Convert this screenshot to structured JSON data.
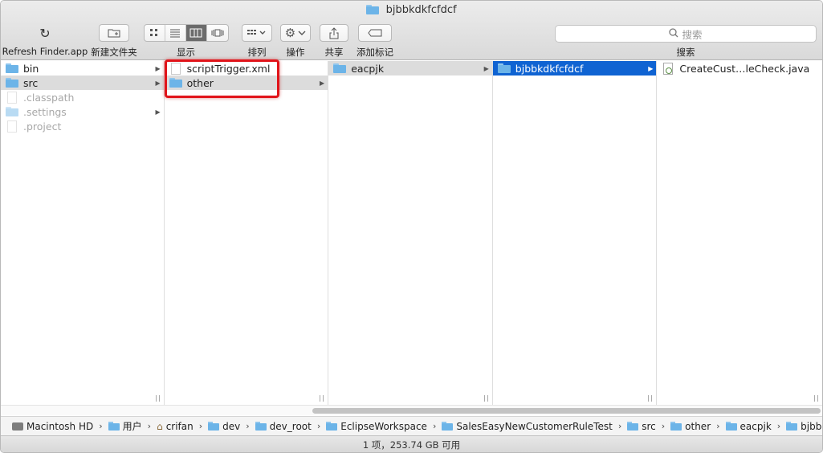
{
  "window": {
    "title": "bjbbkdkfcfdcf"
  },
  "toolbar": {
    "refresh_label": "Refresh Finder.app",
    "new_folder_label": "新建文件夹",
    "view_label": "显示",
    "arrange_label": "排列",
    "action_label": "操作",
    "share_label": "共享",
    "tag_label": "添加标记",
    "search_placeholder": "搜索",
    "search_label": "搜索"
  },
  "columns": [
    {
      "items": [
        {
          "name": "bin",
          "kind": "folder",
          "arrow": true
        },
        {
          "name": "src",
          "kind": "folder",
          "arrow": true,
          "selected": "gray"
        },
        {
          "name": ".classpath",
          "kind": "file",
          "dim": true
        },
        {
          "name": ".settings",
          "kind": "folder",
          "arrow": true,
          "dim": true
        },
        {
          "name": ".project",
          "kind": "file",
          "dim": true
        }
      ]
    },
    {
      "items": [
        {
          "name": "scriptTrigger.xml",
          "kind": "file"
        },
        {
          "name": "other",
          "kind": "folder",
          "arrow": true,
          "selected": "gray"
        }
      ]
    },
    {
      "items": [
        {
          "name": "eacpjk",
          "kind": "folder",
          "arrow": true,
          "selected": "gray"
        }
      ]
    },
    {
      "items": [
        {
          "name": "bjbbkdkfcfdcf",
          "kind": "folder",
          "arrow": true,
          "selected": "blue"
        }
      ]
    },
    {
      "items": [
        {
          "name": "CreateCust…leCheck.java",
          "kind": "java"
        }
      ]
    }
  ],
  "pathbar": [
    {
      "label": "Macintosh HD",
      "icon": "disk-icon"
    },
    {
      "label": "用户",
      "icon": "folder-icon"
    },
    {
      "label": "crifan",
      "icon": "home-icon"
    },
    {
      "label": "dev",
      "icon": "folder-icon"
    },
    {
      "label": "dev_root",
      "icon": "folder-icon"
    },
    {
      "label": "EclipseWorkspace",
      "icon": "folder-icon"
    },
    {
      "label": "SalesEasyNewCustomerRuleTest",
      "icon": "folder-icon"
    },
    {
      "label": "src",
      "icon": "folder-icon"
    },
    {
      "label": "other",
      "icon": "folder-icon"
    },
    {
      "label": "eacpjk",
      "icon": "folder-icon"
    },
    {
      "label": "bjbbkdkfcfdcf",
      "icon": "folder-icon"
    }
  ],
  "status": {
    "text": "1 项，253.74 GB 可用"
  },
  "colors": {
    "selection_blue": "#0f63d2",
    "highlight_red": "#e1141a",
    "folder_blue": "#6cb4e8"
  }
}
